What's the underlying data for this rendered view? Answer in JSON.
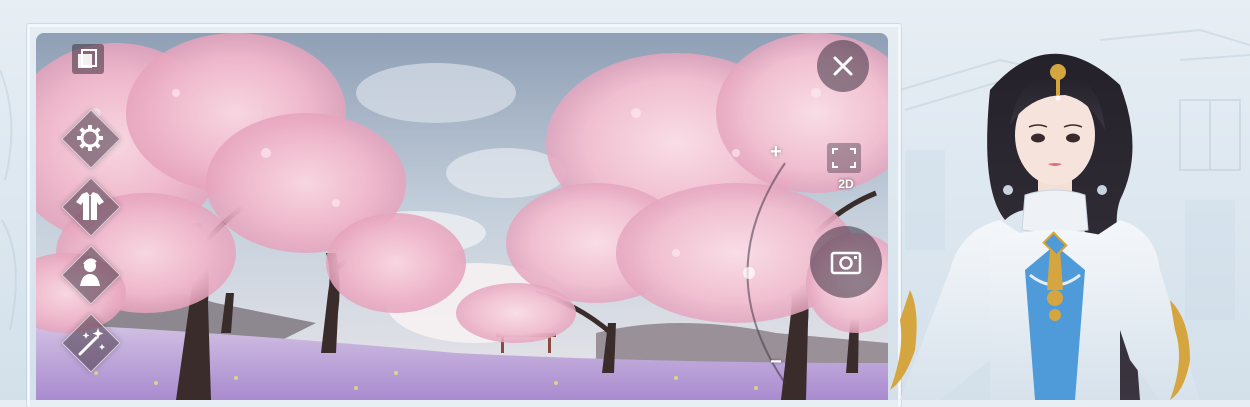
{
  "hud": {
    "left": [
      {
        "icon": "copy-icon"
      },
      {
        "icon": "gear-icon"
      },
      {
        "icon": "outfit-icon"
      },
      {
        "icon": "character-pose-icon"
      },
      {
        "icon": "magic-wand-icon"
      }
    ],
    "right": {
      "close_icon": "close-icon",
      "fullscreen_icon": "fullscreen-icon",
      "mode_label": "2D",
      "camera_icon": "camera-icon",
      "zoom_in_symbol": "+",
      "zoom_out_symbol": "−"
    }
  },
  "colors": {
    "blossom": "#f2c3d3",
    "blossom_deep": "#e79bb6",
    "lavender_field": "#b89ad6",
    "sky": "#a9b7c9",
    "page_bg": "#e2ebf2",
    "dress_white": "#eef2f6",
    "dress_blue": "#4f9bd9",
    "gold": "#d5a640"
  }
}
